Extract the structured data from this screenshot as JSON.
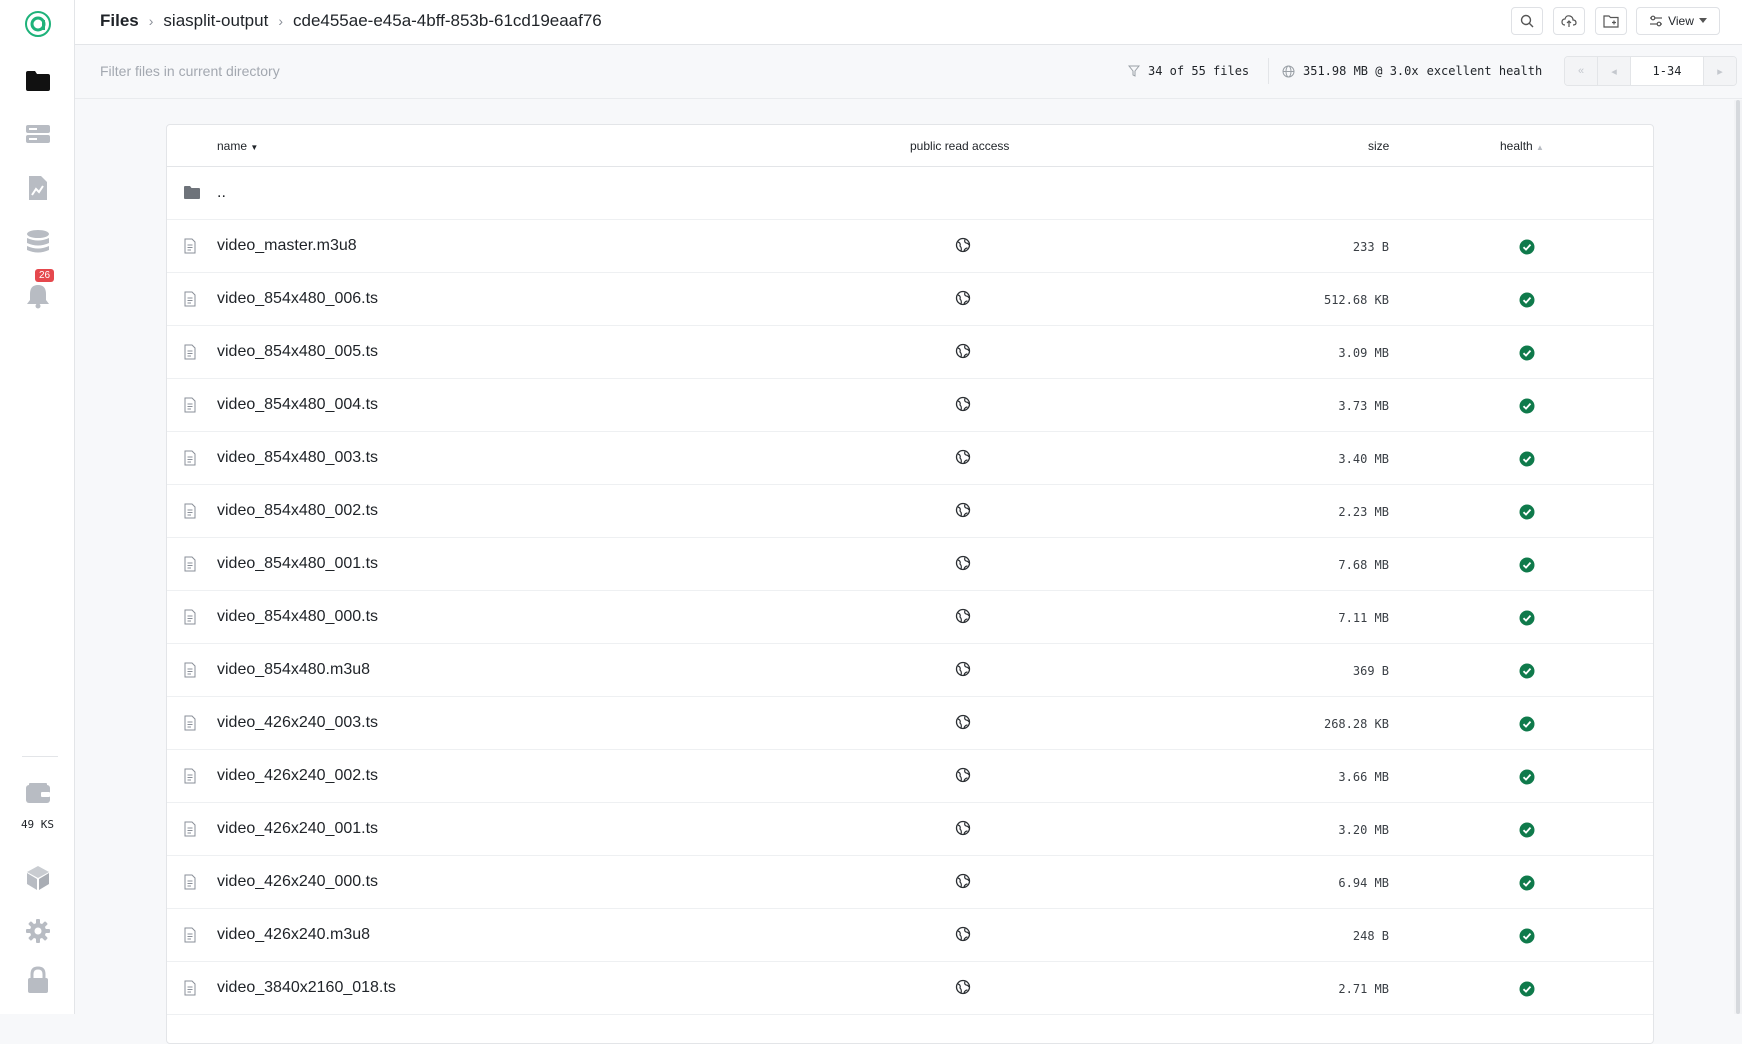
{
  "sidebar": {
    "notification_count": "26",
    "storage_label": "49 KS"
  },
  "breadcrumb": {
    "items": [
      "Files",
      "siasplit-output",
      "cde455ae-e45a-4bff-853b-61cd19eaaf76"
    ]
  },
  "header": {
    "view_label": "View"
  },
  "filter": {
    "placeholder": "Filter files in current directory",
    "count_text": "34 of 55 files",
    "size_text": "351.98 MB @ 3.0x",
    "health_text": "excellent health",
    "page_range": "1-34"
  },
  "table": {
    "headers": {
      "name": "name",
      "access": "public read access",
      "size": "size",
      "health": "health"
    },
    "parent_label": "..",
    "rows": [
      {
        "name": "video_master.m3u8",
        "size": "233 B"
      },
      {
        "name": "video_854x480_006.ts",
        "size": "512.68 KB"
      },
      {
        "name": "video_854x480_005.ts",
        "size": "3.09 MB"
      },
      {
        "name": "video_854x480_004.ts",
        "size": "3.73 MB"
      },
      {
        "name": "video_854x480_003.ts",
        "size": "3.40 MB"
      },
      {
        "name": "video_854x480_002.ts",
        "size": "2.23 MB"
      },
      {
        "name": "video_854x480_001.ts",
        "size": "7.68 MB"
      },
      {
        "name": "video_854x480_000.ts",
        "size": "7.11 MB"
      },
      {
        "name": "video_854x480.m3u8",
        "size": "369 B"
      },
      {
        "name": "video_426x240_003.ts",
        "size": "268.28 KB"
      },
      {
        "name": "video_426x240_002.ts",
        "size": "3.66 MB"
      },
      {
        "name": "video_426x240_001.ts",
        "size": "3.20 MB"
      },
      {
        "name": "video_426x240_000.ts",
        "size": "6.94 MB"
      },
      {
        "name": "video_426x240.m3u8",
        "size": "248 B"
      },
      {
        "name": "video_3840x2160_018.ts",
        "size": "2.71 MB"
      }
    ]
  },
  "colors": {
    "health_ok": "#0f7a4b",
    "badge": "#e5484d",
    "brand": "#1eb27a"
  }
}
